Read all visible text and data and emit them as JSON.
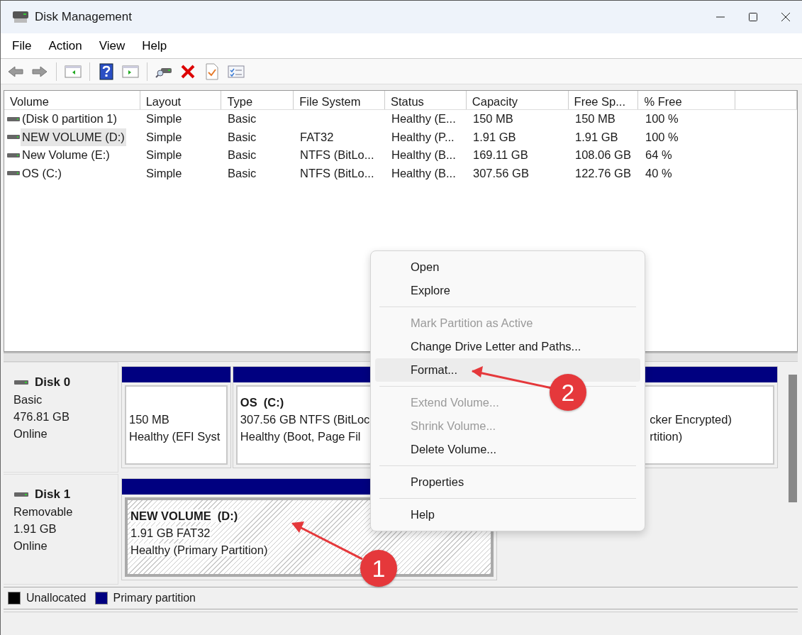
{
  "window": {
    "title": "Disk Management"
  },
  "menu_bar": [
    "File",
    "Action",
    "View",
    "Help"
  ],
  "volumes": {
    "columns": [
      "Volume",
      "Layout",
      "Type",
      "File System",
      "Status",
      "Capacity",
      "Free Sp...",
      "% Free"
    ],
    "rows": [
      {
        "volume": "(Disk 0 partition 1)",
        "layout": "Simple",
        "type": "Basic",
        "status": "Healthy (E...",
        "capacity": "150 MB",
        "free_space": "150 MB",
        "percent_free": "100 %",
        "selected": false
      },
      {
        "volume": "NEW VOLUME (D:)",
        "layout": "Simple",
        "type": "Basic",
        "file_system": "FAT32",
        "status": "Healthy (P...",
        "capacity": "1.91 GB",
        "free_space": "1.91 GB",
        "percent_free": "100 %",
        "selected": true
      },
      {
        "volume": "New Volume (E:)",
        "layout": "Simple",
        "type": "Basic",
        "file_system": "NTFS (BitLo...",
        "status": "Healthy (B...",
        "capacity": "169.11 GB",
        "free_space": "108.06 GB",
        "percent_free": "64 %",
        "selected": false
      },
      {
        "volume": "OS (C:)",
        "layout": "Simple",
        "type": "Basic",
        "file_system": "NTFS (BitLo...",
        "status": "Healthy (B...",
        "capacity": "307.56 GB",
        "free_space": "122.76 GB",
        "percent_free": "40 %",
        "selected": false
      }
    ]
  },
  "disks": [
    {
      "name": "Disk 0",
      "lines": [
        "Basic",
        "476.81 GB",
        "Online"
      ],
      "partitions": [
        {
          "lines": [
            "150 MB",
            "Healthy (EFI Syst"
          ],
          "selected": false
        },
        {
          "title": "OS  (C:)",
          "lines": [
            "307.56 GB NTFS (BitLoc",
            "Healthy (Boot, Page Fil"
          ],
          "selected": false
        },
        {
          "lines": [
            "cker Encrypted)",
            "rtition)"
          ],
          "selected": false
        }
      ]
    },
    {
      "name": "Disk 1",
      "lines": [
        "Removable",
        "1.91 GB",
        "Online"
      ],
      "partitions": [
        {
          "title": "NEW VOLUME  (D:)",
          "lines": [
            "1.91 GB FAT32",
            "Healthy (Primary Partition)"
          ],
          "selected": true
        }
      ]
    }
  ],
  "legend": [
    {
      "label": "Unallocated",
      "color": "#000000"
    },
    {
      "label": "Primary partition",
      "color": "#000080"
    }
  ],
  "context_menu": {
    "items": [
      {
        "kind": "item",
        "label": "Open",
        "disabled": false,
        "selected": false
      },
      {
        "kind": "item",
        "label": "Explore",
        "disabled": false,
        "selected": false
      },
      {
        "kind": "separator"
      },
      {
        "kind": "item",
        "label": "Mark Partition as Active",
        "disabled": true,
        "selected": false
      },
      {
        "kind": "item",
        "label": "Change Drive Letter and Paths...",
        "disabled": false,
        "selected": false
      },
      {
        "kind": "item",
        "label": "Format...",
        "disabled": false,
        "selected": true
      },
      {
        "kind": "separator"
      },
      {
        "kind": "item",
        "label": "Extend Volume...",
        "disabled": true,
        "selected": false
      },
      {
        "kind": "item",
        "label": "Shrink Volume...",
        "disabled": true,
        "selected": false
      },
      {
        "kind": "item",
        "label": "Delete Volume...",
        "disabled": false,
        "selected": false
      },
      {
        "kind": "separator"
      },
      {
        "kind": "item",
        "label": "Properties",
        "disabled": false,
        "selected": false
      },
      {
        "kind": "separator"
      },
      {
        "kind": "item",
        "label": "Help",
        "disabled": false,
        "selected": false
      }
    ]
  },
  "annotations": [
    {
      "label": "1"
    },
    {
      "label": "2"
    }
  ]
}
